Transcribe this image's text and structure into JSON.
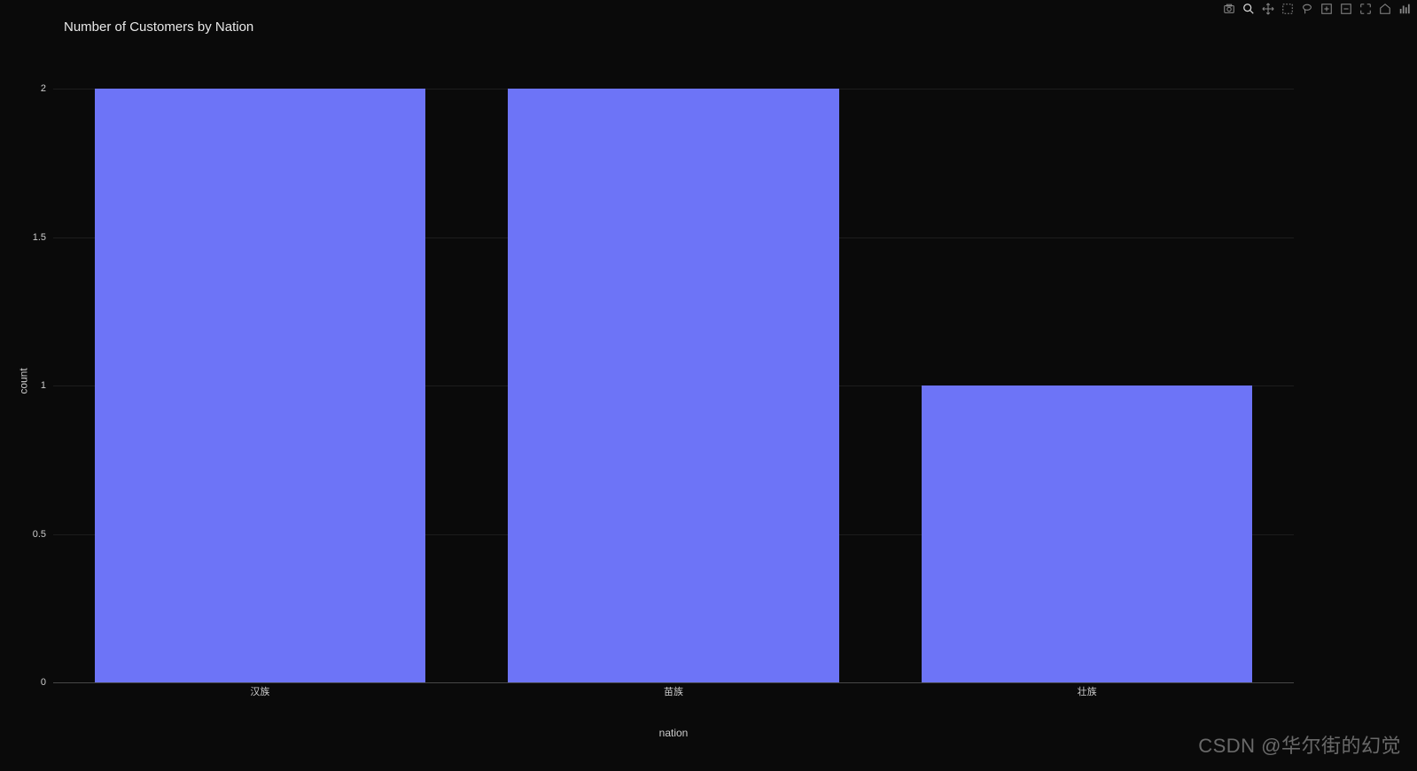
{
  "chart_data": {
    "type": "bar",
    "title": "Number of Customers by Nation",
    "xlabel": "nation",
    "ylabel": "count",
    "categories": [
      "汉族",
      "苗族",
      "壮族"
    ],
    "values": [
      2,
      2,
      1
    ],
    "y_ticks": [
      0,
      0.5,
      1,
      1.5,
      2
    ],
    "ylim": [
      0,
      2
    ],
    "bar_color": "#6d74f7"
  },
  "toolbar": {
    "items": [
      {
        "name": "camera-icon",
        "tip": "Download plot as a png"
      },
      {
        "name": "zoom-icon",
        "tip": "Zoom",
        "active": true
      },
      {
        "name": "pan-icon",
        "tip": "Pan"
      },
      {
        "name": "box-select-icon",
        "tip": "Box Select"
      },
      {
        "name": "lasso-select-icon",
        "tip": "Lasso Select"
      },
      {
        "name": "zoom-in-icon",
        "tip": "Zoom in"
      },
      {
        "name": "zoom-out-icon",
        "tip": "Zoom out"
      },
      {
        "name": "autoscale-icon",
        "tip": "Autoscale"
      },
      {
        "name": "reset-axes-icon",
        "tip": "Reset axes"
      },
      {
        "name": "plotly-logo-icon",
        "tip": "Produced with Plotly"
      }
    ]
  },
  "watermark": "CSDN @华尔街的幻觉"
}
